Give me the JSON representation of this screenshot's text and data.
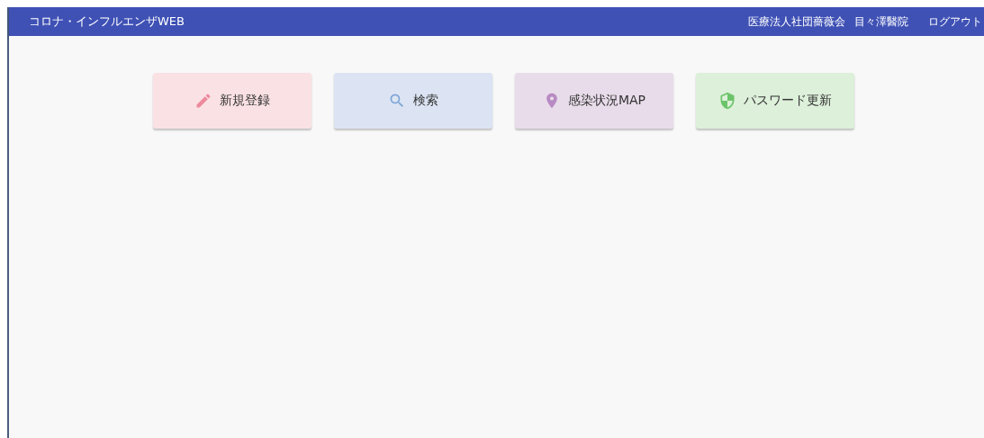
{
  "header": {
    "title": "コロナ・インフルエンザWEB",
    "organization": "医療法人社団薔薇会",
    "clinic": "目々澤醫院",
    "logout": "ログアウト"
  },
  "menu_buttons": [
    {
      "kind": "pencil",
      "label": "新規登録",
      "color": "#fae1e4"
    },
    {
      "kind": "search",
      "label": "検索",
      "color": "#dce4f3"
    },
    {
      "kind": "pin",
      "label": "感染状況MAP",
      "color": "#e8dcea"
    },
    {
      "kind": "shield",
      "label": "パスワード更新",
      "color": "#ddf0da"
    }
  ]
}
